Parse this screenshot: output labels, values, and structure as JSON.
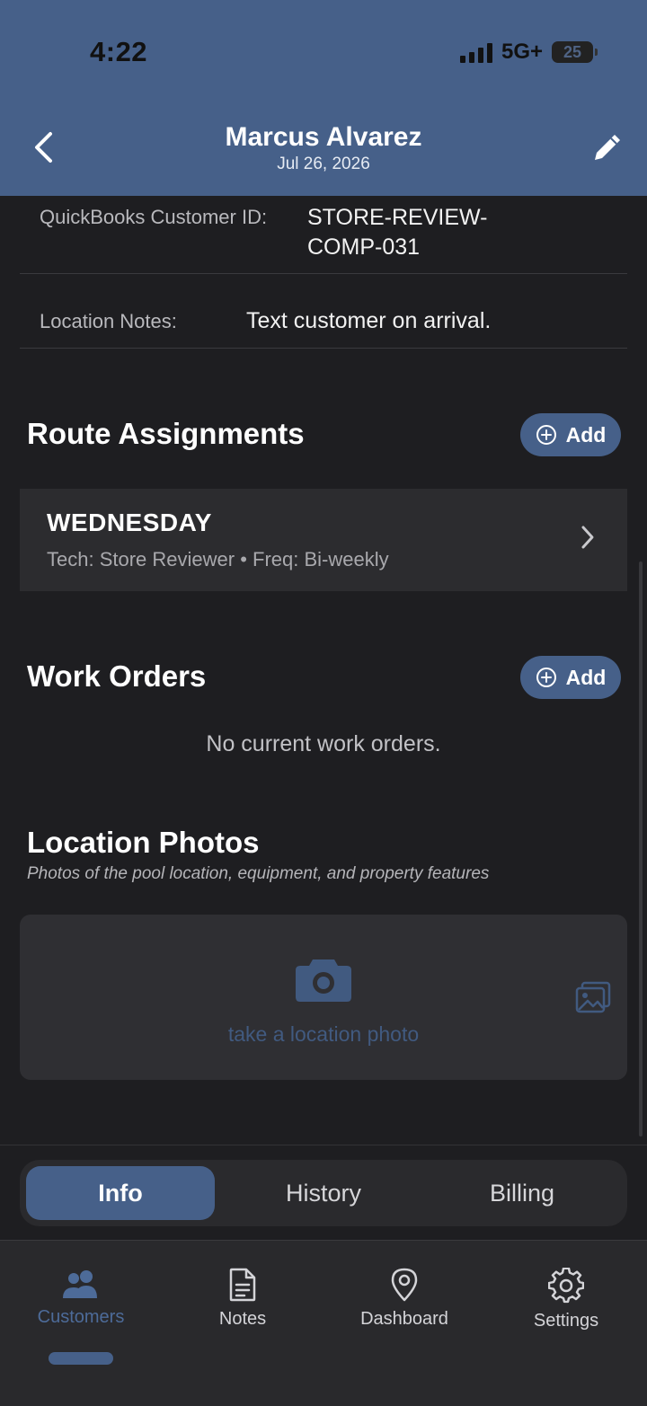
{
  "status_bar": {
    "time": "4:22",
    "network": "5G+",
    "battery": "25"
  },
  "header": {
    "title": "Marcus Alvarez",
    "date": "Jul 26, 2026"
  },
  "info": {
    "quickbooks_label": "QuickBooks Customer ID:",
    "quickbooks_value_line1": "STORE-REVIEW-",
    "quickbooks_value_line2": "COMP-031",
    "location_notes_label": "Location Notes:",
    "location_notes_value": "Text customer on arrival."
  },
  "route_assignments": {
    "title": "Route Assignments",
    "add_label": "Add",
    "items": [
      {
        "day": "WEDNESDAY",
        "meta": "Tech: Store Reviewer • Freq: Bi-weekly"
      }
    ]
  },
  "work_orders": {
    "title": "Work Orders",
    "add_label": "Add",
    "empty_text": "No current work orders."
  },
  "location_photos": {
    "title": "Location Photos",
    "subtitle": "Photos of the pool location, equipment, and property features",
    "cta": "take a location photo"
  },
  "segments": {
    "items": [
      {
        "label": "Info",
        "active": true
      },
      {
        "label": "History",
        "active": false
      },
      {
        "label": "Billing",
        "active": false
      }
    ]
  },
  "tabbar": {
    "items": [
      {
        "label": "Customers",
        "icon": "customers-icon",
        "active": true
      },
      {
        "label": "Notes",
        "icon": "notes-icon",
        "active": false
      },
      {
        "label": "Dashboard",
        "icon": "location-pin-icon",
        "active": false
      },
      {
        "label": "Settings",
        "icon": "gear-icon",
        "active": false
      }
    ]
  },
  "colors": {
    "accent": "#466089",
    "background": "#1e1e21",
    "card": "#2c2c2f",
    "muted_accent": "#415a80"
  }
}
